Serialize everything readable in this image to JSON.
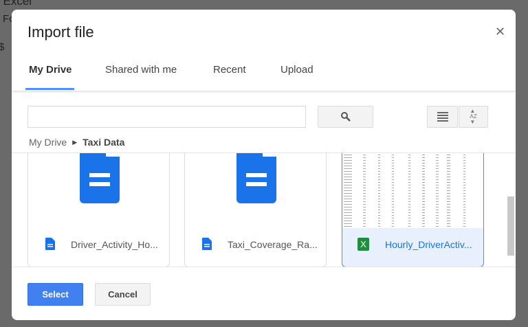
{
  "background": {
    "title_fragment": "l Excel",
    "menu_fragment": "Fo",
    "toolbar_fragment": "$"
  },
  "dialog": {
    "title": "Import file",
    "close_icon": "close-icon",
    "tabs": [
      {
        "label": "My Drive",
        "active": true
      },
      {
        "label": "Shared with me"
      },
      {
        "label": "Recent"
      },
      {
        "label": "Upload"
      }
    ],
    "search": {
      "value": "",
      "placeholder": ""
    },
    "breadcrumb": {
      "root": "My Drive",
      "current": "Taxi Data"
    },
    "files": [
      {
        "name": "Driver_Activity_Ho...",
        "type": "google-doc"
      },
      {
        "name": "Taxi_Coverage_Ra...",
        "type": "google-doc"
      },
      {
        "name": "Hourly_DriverActiv...",
        "type": "excel",
        "selected": true
      }
    ],
    "footer": {
      "select_label": "Select",
      "cancel_label": "Cancel"
    }
  },
  "colors": {
    "accent": "#4d90fe",
    "doc_blue": "#1a73e8",
    "excel_green": "#1e8e3e"
  }
}
